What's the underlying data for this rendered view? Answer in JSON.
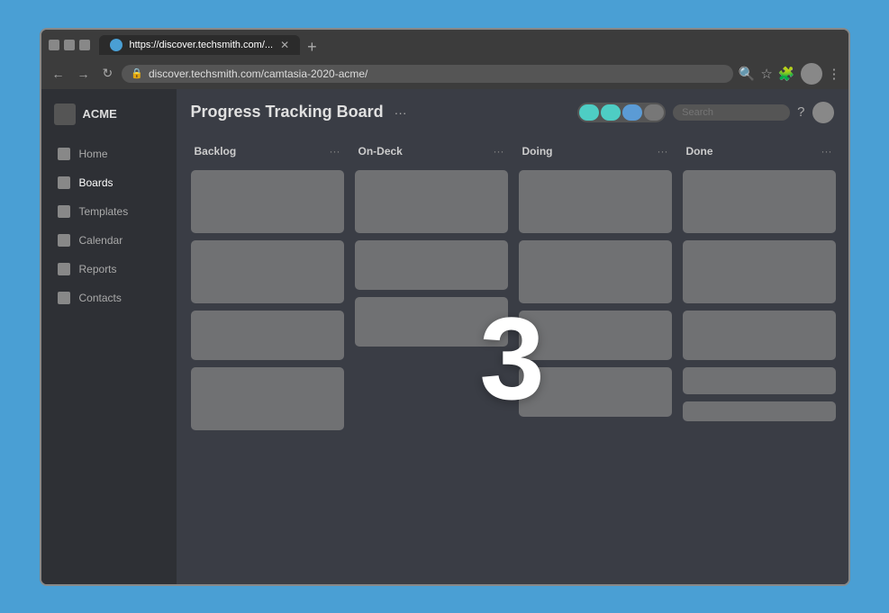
{
  "browser": {
    "url": "discover.techsmith.com/camtasia-2020-acme/",
    "tab_label": "https://discover.techsmith.com/...",
    "new_tab_label": "+"
  },
  "nav": {
    "back": "←",
    "forward": "→",
    "refresh": "↻",
    "dots": "⋮"
  },
  "toolbar": {
    "search_icon": "🔍",
    "star_icon": "☆",
    "ext_icon": "🧩",
    "account_icon": "👤",
    "menu_icon": "⋮"
  },
  "sidebar": {
    "logo": "ACME",
    "items": [
      {
        "label": "Home",
        "icon": "home"
      },
      {
        "label": "Boards",
        "icon": "boards"
      },
      {
        "label": "Templates",
        "icon": "templates"
      },
      {
        "label": "Calendar",
        "icon": "calendar"
      },
      {
        "label": "Reports",
        "icon": "reports"
      },
      {
        "label": "Contacts",
        "icon": "contacts"
      }
    ]
  },
  "page": {
    "title": "Progress Tracking Board",
    "menu_dots": "···"
  },
  "board": {
    "columns": [
      {
        "id": "backlog",
        "title": "Backlog",
        "dots": "···",
        "cards": [
          {
            "height": "tall"
          },
          {
            "height": "tall"
          },
          {
            "height": "medium"
          },
          {
            "height": "tall"
          }
        ]
      },
      {
        "id": "on-deck",
        "title": "On-Deck",
        "dots": "···",
        "cards": [
          {
            "height": "tall"
          },
          {
            "height": "medium"
          },
          {
            "height": "medium"
          }
        ]
      },
      {
        "id": "doing",
        "title": "Doing",
        "dots": "···",
        "cards": [
          {
            "height": "tall"
          },
          {
            "height": "tall"
          },
          {
            "height": "medium"
          },
          {
            "height": "medium"
          }
        ]
      },
      {
        "id": "done",
        "title": "Done",
        "dots": "···",
        "cards": [
          {
            "height": "tall"
          },
          {
            "height": "tall"
          },
          {
            "height": "medium"
          },
          {
            "height": "short"
          },
          {
            "height": "xshort"
          }
        ]
      }
    ]
  },
  "overlay_number": "3"
}
